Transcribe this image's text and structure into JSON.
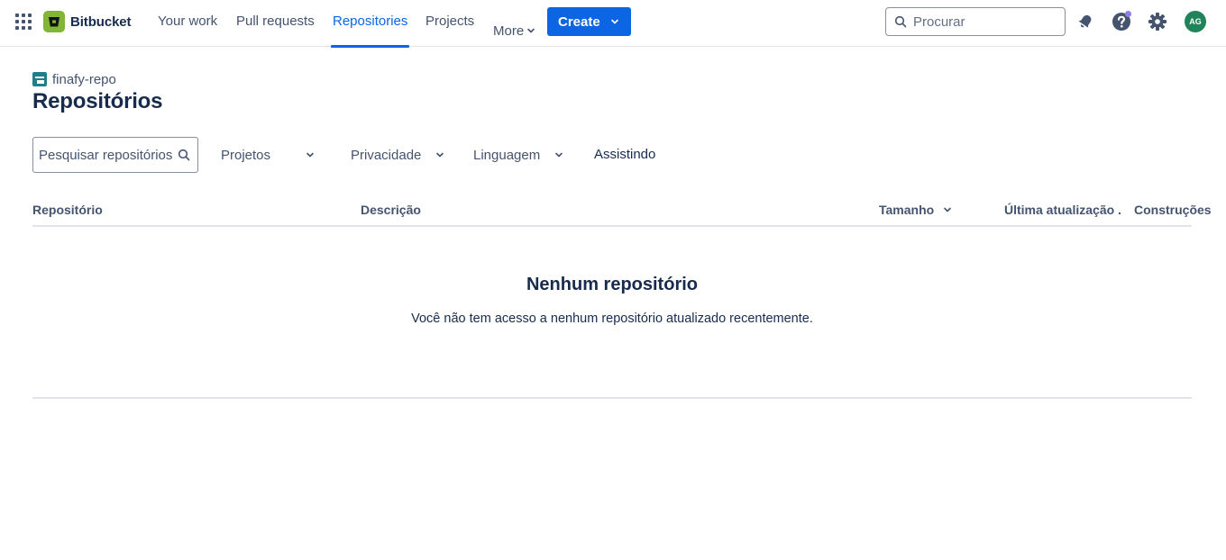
{
  "topnav": {
    "app_switcher_icon": "grid-icon",
    "product_name": "Bitbucket",
    "items": [
      {
        "label": "Your work",
        "active": false
      },
      {
        "label": "Pull requests",
        "active": false
      },
      {
        "label": "Repositories",
        "active": true
      },
      {
        "label": "Projects",
        "active": false
      }
    ],
    "more_label": "More",
    "create_label": "Create",
    "search_placeholder": "Procurar",
    "icons": [
      "notifications-icon",
      "help-icon",
      "settings-icon"
    ],
    "avatar_initials": "AG",
    "accent_color": "#0c66e4"
  },
  "header": {
    "breadcrumb": "finafy-repo",
    "title": "Repositórios"
  },
  "filters": {
    "search_placeholder": "Pesquisar repositórios",
    "projects_label": "Projetos",
    "privacy_label": "Privacidade",
    "language_label": "Linguagem",
    "watching_label": "Assistindo"
  },
  "table": {
    "columns": [
      {
        "label": "Repositório"
      },
      {
        "label": "Descrição"
      },
      {
        "label": "Tamanho",
        "sortable": true
      },
      {
        "label": "Última atualização ."
      },
      {
        "label": "Construções"
      }
    ],
    "rows": []
  },
  "empty_state": {
    "title": "Nenhum repositório",
    "description": "Você não tem acesso a nenhum repositório atualizado recentemente."
  }
}
